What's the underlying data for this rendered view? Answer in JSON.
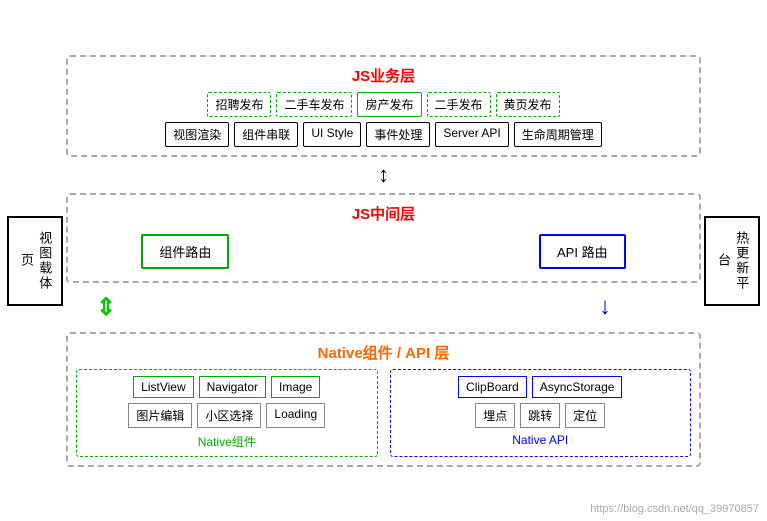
{
  "leftBox": {
    "label": "视图载体页"
  },
  "rightBox": {
    "label": "热更新平台"
  },
  "jsBusinessLayer": {
    "title": "JS业务层",
    "topRow": [
      {
        "text": "招聘发布",
        "style": "dashed"
      },
      {
        "text": "二手车发布",
        "style": "dashed"
      },
      {
        "text": "房产发布",
        "style": "solid-green"
      },
      {
        "text": "二手发布",
        "style": "dashed"
      },
      {
        "text": "黄页发布",
        "style": "dashed"
      }
    ],
    "bottomRow": [
      {
        "text": "视图渲染"
      },
      {
        "text": "组件串联"
      },
      {
        "text": "UI Style"
      },
      {
        "text": "事件处理"
      },
      {
        "text": "Server API"
      },
      {
        "text": "生命周期管理"
      }
    ]
  },
  "jsMidLayer": {
    "title": "JS中间层",
    "leftBox": "组件路由",
    "rightBox": "API 路由"
  },
  "nativeLayer": {
    "title": "Native组件 / API 层",
    "leftSection": {
      "row1": [
        "ListView",
        "Navigator",
        "Image"
      ],
      "row2": [
        "图片编辑",
        "小区选择",
        "Loading"
      ],
      "label": "Native组件"
    },
    "rightSection": {
      "row1": [
        "ClipBoard",
        "AsyncStorage"
      ],
      "row2": [
        "埋点",
        "跳转",
        "定位"
      ],
      "label": "Native API"
    }
  },
  "watermark": "https://blog.csdn.net/qq_39970857",
  "arrows": {
    "updown": "↕",
    "right": "→",
    "left": "←",
    "down": "↓",
    "greenDown": "↓",
    "blueDown": "↓"
  }
}
